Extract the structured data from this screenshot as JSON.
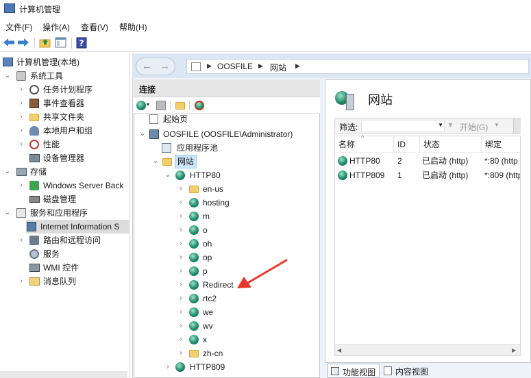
{
  "window": {
    "title": "计算机管理"
  },
  "menu": [
    "文件(F)",
    "操作(A)",
    "查看(V)",
    "帮助(H)"
  ],
  "left_tree": [
    {
      "label": "计算机管理(本地)"
    },
    {
      "label": "系统工具"
    },
    {
      "label": "任务计划程序"
    },
    {
      "label": "事件查看器"
    },
    {
      "label": "共享文件夹"
    },
    {
      "label": "本地用户和组"
    },
    {
      "label": "性能"
    },
    {
      "label": "设备管理器"
    },
    {
      "label": "存储"
    },
    {
      "label": "Windows Server Back"
    },
    {
      "label": "磁盘管理"
    },
    {
      "label": "服务和应用程序"
    },
    {
      "label": "Internet Information S"
    },
    {
      "label": "路由和远程访问"
    },
    {
      "label": "服务"
    },
    {
      "label": "WMI 控件"
    },
    {
      "label": "消息队列"
    }
  ],
  "address": {
    "segments": [
      "OOSFILE",
      "网站"
    ]
  },
  "connections": {
    "title": "连接",
    "tree": [
      {
        "label": "起始页"
      },
      {
        "label": "OOSFILE (OOSFILE\\Administrator)"
      },
      {
        "label": "应用程序池"
      },
      {
        "label": "网站"
      },
      {
        "label": "HTTP80"
      },
      {
        "label": "en-us"
      },
      {
        "label": "hosting"
      },
      {
        "label": "m"
      },
      {
        "label": "o"
      },
      {
        "label": "oh"
      },
      {
        "label": "op"
      },
      {
        "label": "p"
      },
      {
        "label": "Redirect"
      },
      {
        "label": "rtc2"
      },
      {
        "label": "we"
      },
      {
        "label": "wv"
      },
      {
        "label": "x"
      },
      {
        "label": "zh-cn"
      },
      {
        "label": "HTTP809"
      }
    ]
  },
  "content": {
    "title": "网站",
    "filter_label": "筛选:",
    "start_label": "开始(G)",
    "columns": [
      "名称",
      "ID",
      "状态",
      "绑定"
    ],
    "rows": [
      {
        "name": "HTTP80",
        "id": "2",
        "status": "已启动 (http)",
        "binding": "*:80 (http"
      },
      {
        "name": "HTTP809",
        "id": "1",
        "status": "已启动 (http)",
        "binding": "*:809 (http"
      }
    ]
  },
  "bottom_tabs": [
    "功能视图",
    "内容视图"
  ],
  "colors": {
    "accent": "#2f7fd3",
    "arrow": "#e8372c",
    "globe": "#1e8a6a"
  }
}
